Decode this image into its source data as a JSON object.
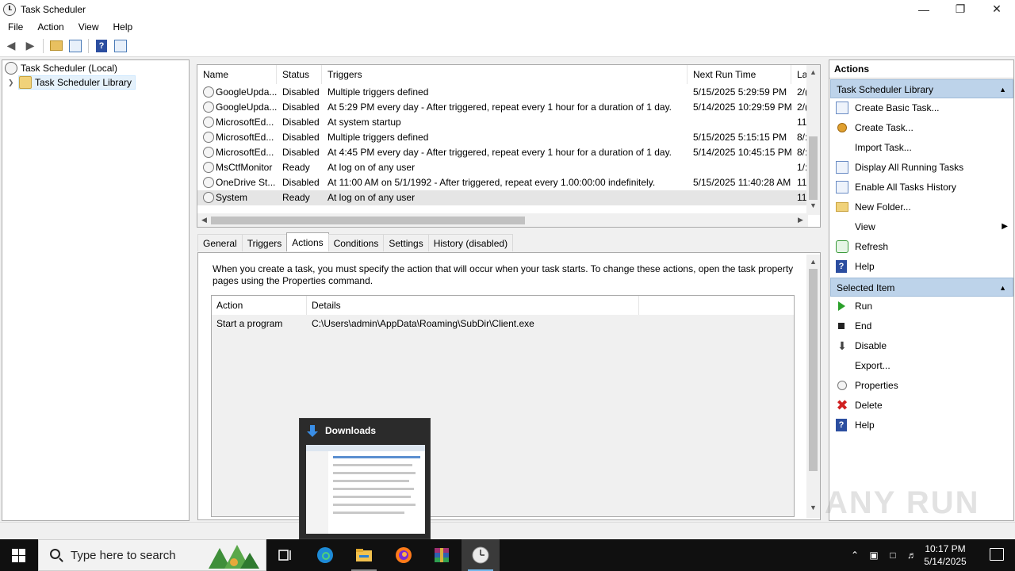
{
  "window": {
    "title": "Task Scheduler",
    "controls": [
      "minimize-icon",
      "restore-icon",
      "close-icon"
    ]
  },
  "menu": [
    "File",
    "Action",
    "View",
    "Help"
  ],
  "tree": {
    "root": "Task Scheduler (Local)",
    "child": "Task Scheduler Library"
  },
  "tasklist": {
    "columns": [
      "Name",
      "Status",
      "Triggers",
      "Next Run Time",
      "La"
    ],
    "rows": [
      {
        "name": "GoogleUpda...",
        "status": "Disabled",
        "triggers": "Multiple triggers defined",
        "next": "5/15/2025 5:29:59 PM",
        "last": "2/("
      },
      {
        "name": "GoogleUpda...",
        "status": "Disabled",
        "triggers": "At 5:29 PM every day - After triggered, repeat every 1 hour for a duration of 1 day.",
        "next": "5/14/2025 10:29:59 PM",
        "last": "2/("
      },
      {
        "name": "MicrosoftEd...",
        "status": "Disabled",
        "triggers": "At system startup",
        "next": "",
        "last": "11."
      },
      {
        "name": "MicrosoftEd...",
        "status": "Disabled",
        "triggers": "Multiple triggers defined",
        "next": "5/15/2025 5:15:15 PM",
        "last": "8/:"
      },
      {
        "name": "MicrosoftEd...",
        "status": "Disabled",
        "triggers": "At 4:45 PM every day - After triggered, repeat every 1 hour for a duration of 1 day.",
        "next": "5/14/2025 10:45:15 PM",
        "last": "8/:"
      },
      {
        "name": "MsCtfMonitor",
        "status": "Ready",
        "triggers": "At log on of any user",
        "next": "",
        "last": "1/:"
      },
      {
        "name": "OneDrive St...",
        "status": "Disabled",
        "triggers": "At 11:00 AM on 5/1/1992 - After triggered, repeat every 1.00:00:00 indefinitely.",
        "next": "5/15/2025 11:40:28 AM",
        "last": "11."
      },
      {
        "name": "System",
        "status": "Ready",
        "triggers": "At log on of any user",
        "next": "",
        "last": "11."
      }
    ],
    "selected_row": 7
  },
  "tabs": [
    "General",
    "Triggers",
    "Actions",
    "Conditions",
    "Settings",
    "History (disabled)"
  ],
  "active_tab": "Actions",
  "actions_tab": {
    "description": "When you create a task, you must specify the action that will occur when your task starts.  To change these actions, open the task property pages using the Properties command.",
    "columns": [
      "Action",
      "Details"
    ],
    "row": {
      "action": "Start a program",
      "details": "C:\\Users\\admin\\AppData\\Roaming\\SubDir\\Client.exe"
    }
  },
  "actions_pane": {
    "title": "Actions",
    "section1": "Task Scheduler Library",
    "items1": [
      {
        "label": "Create Basic Task...",
        "icon": "create-basic-task-icon"
      },
      {
        "label": "Create Task...",
        "icon": "create-task-icon"
      },
      {
        "label": "Import Task...",
        "icon": ""
      },
      {
        "label": "Display All Running Tasks",
        "icon": "running-tasks-icon"
      },
      {
        "label": "Enable All Tasks History",
        "icon": "history-icon"
      },
      {
        "label": "New Folder...",
        "icon": "folder-icon"
      },
      {
        "label": "View",
        "icon": ""
      },
      {
        "label": "Refresh",
        "icon": "refresh-icon"
      },
      {
        "label": "Help",
        "icon": "help-icon"
      }
    ],
    "section2": "Selected Item",
    "items2": [
      {
        "label": "Run",
        "icon": "run-icon"
      },
      {
        "label": "End",
        "icon": "end-icon"
      },
      {
        "label": "Disable",
        "icon": "disable-icon"
      },
      {
        "label": "Export...",
        "icon": ""
      },
      {
        "label": "Properties",
        "icon": "properties-icon"
      },
      {
        "label": "Delete",
        "icon": "delete-icon"
      },
      {
        "label": "Help",
        "icon": "help-icon"
      }
    ]
  },
  "thumbnail": {
    "title": "Downloads"
  },
  "watermark": "ANY RUN",
  "taskbar": {
    "search_placeholder": "Type here to search",
    "time": "10:17 PM",
    "date": "5/14/2025"
  },
  "colors": {
    "section_header": "#bdd3ea",
    "taskbar": "#101010",
    "selection": "#e5f1fb"
  }
}
